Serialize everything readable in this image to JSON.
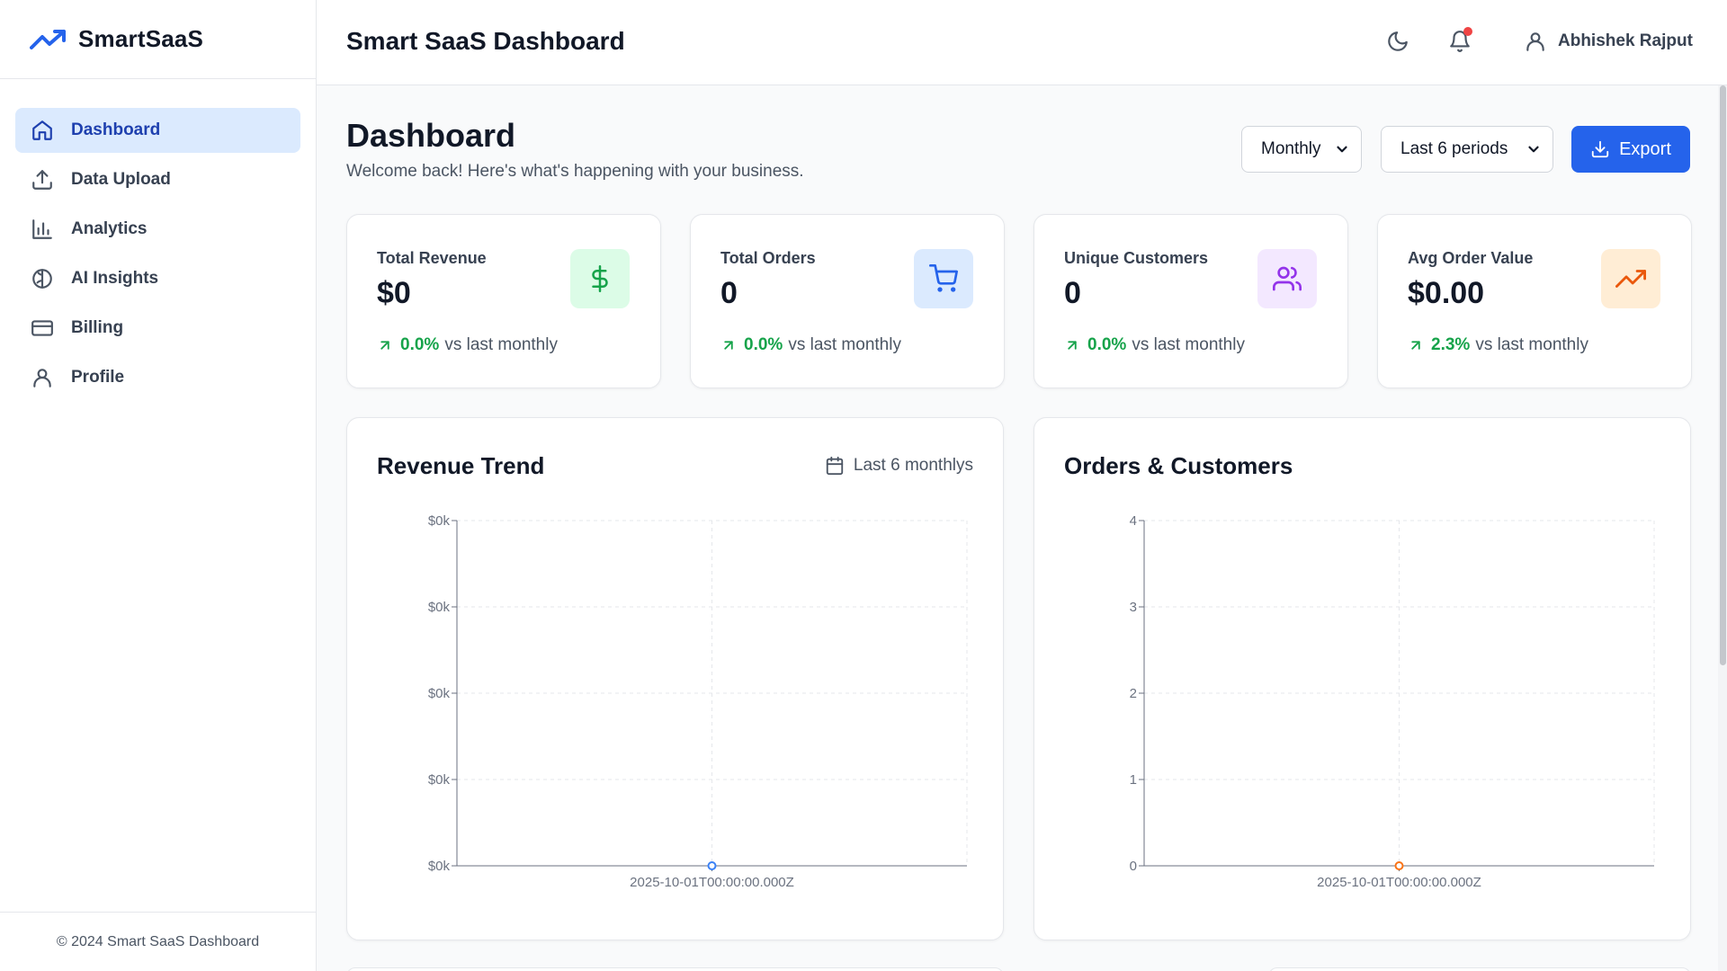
{
  "brand": {
    "name": "SmartSaaS",
    "accent": "#2563eb"
  },
  "sidebar": {
    "items": [
      {
        "label": "Dashboard",
        "icon": "home-icon",
        "active": true
      },
      {
        "label": "Data Upload",
        "icon": "upload-icon"
      },
      {
        "label": "Analytics",
        "icon": "bar-chart-icon"
      },
      {
        "label": "AI Insights",
        "icon": "brain-icon"
      },
      {
        "label": "Billing",
        "icon": "credit-card-icon"
      },
      {
        "label": "Profile",
        "icon": "user-icon"
      }
    ],
    "footer": "© 2024 Smart SaaS Dashboard"
  },
  "header": {
    "title": "Smart SaaS Dashboard",
    "user_name": "Abhishek Rajput",
    "notification_dot_color": "#ef4444"
  },
  "page": {
    "title": "Dashboard",
    "subtitle": "Welcome back! Here's what's happening with your business.",
    "frequency_select": {
      "value": "Monthly"
    },
    "range_select": {
      "value": "Last 6 periods"
    },
    "export_label": "Export"
  },
  "stats": [
    {
      "label": "Total Revenue",
      "value": "$0",
      "change": "0.0%",
      "change_text": "vs last monthly",
      "icon": "dollar-icon",
      "badge_bg": "#dcfce7",
      "icon_color": "#16a34a"
    },
    {
      "label": "Total Orders",
      "value": "0",
      "change": "0.0%",
      "change_text": "vs last monthly",
      "icon": "cart-icon",
      "badge_bg": "#dbeafe",
      "icon_color": "#2563eb"
    },
    {
      "label": "Unique Customers",
      "value": "0",
      "change": "0.0%",
      "change_text": "vs last monthly",
      "icon": "users-icon",
      "badge_bg": "#f3e8ff",
      "icon_color": "#9333ea"
    },
    {
      "label": "Avg Order Value",
      "value": "$0.00",
      "change": "2.3%",
      "change_text": "vs last monthly",
      "icon": "trending-up-icon",
      "badge_bg": "#ffedd5",
      "icon_color": "#ea580c"
    }
  ],
  "charts": {
    "revenue": {
      "title": "Revenue Trend",
      "period": "Last 6 monthlys"
    },
    "orders": {
      "title": "Orders & Customers"
    }
  },
  "chart_data": [
    {
      "type": "line",
      "title": "Revenue Trend",
      "x": [
        "2025-10-01T00:00:00.000Z"
      ],
      "y_tick_labels": [
        "$0k",
        "$0k",
        "$0k",
        "$0k",
        "$0k"
      ],
      "series": [
        {
          "values": [
            0
          ],
          "color": "#3b82f6"
        }
      ],
      "grid": true
    },
    {
      "type": "line",
      "title": "Orders & Customers",
      "x": [
        "2025-10-01T00:00:00.000Z"
      ],
      "y_ticks": [
        0,
        1,
        2,
        3,
        4
      ],
      "ylim": [
        0,
        4
      ],
      "series": [
        {
          "values": [
            0
          ],
          "color": "#f97316"
        }
      ],
      "grid": true
    }
  ]
}
